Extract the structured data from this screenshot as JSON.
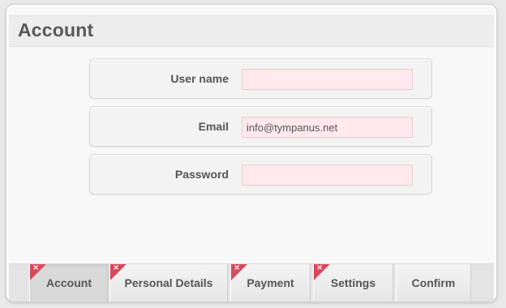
{
  "header": {
    "title": "Account"
  },
  "form": {
    "fields": [
      {
        "label": "User name",
        "value": "",
        "placeholder": ""
      },
      {
        "label": "Email",
        "value": "info@tympanus.net",
        "placeholder": ""
      },
      {
        "label": "Password",
        "value": "",
        "placeholder": ""
      }
    ]
  },
  "tabs": [
    {
      "label": "Account",
      "active": true,
      "error": true
    },
    {
      "label": "Personal Details",
      "active": false,
      "error": true
    },
    {
      "label": "Payment",
      "active": false,
      "error": true
    },
    {
      "label": "Settings",
      "active": false,
      "error": true
    },
    {
      "label": "Confirm",
      "active": false,
      "error": false
    }
  ],
  "colors": {
    "error_flag": "#d8485a",
    "input_invalid_bg": "#ffe9ec"
  },
  "icons": {
    "error_flag": "error-x-icon"
  }
}
